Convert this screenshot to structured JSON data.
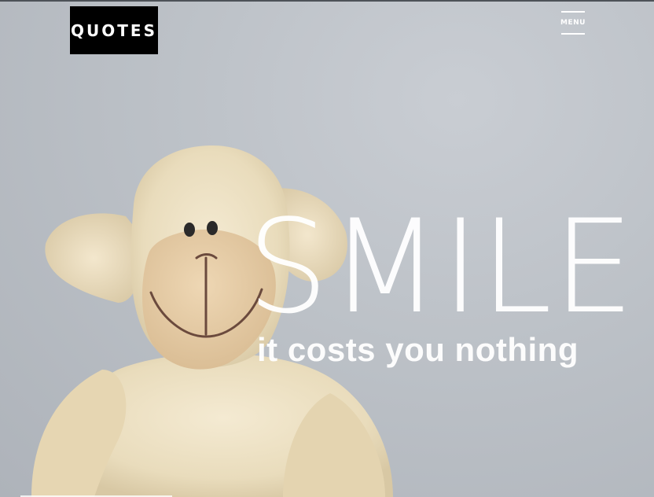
{
  "header": {
    "logo_text": "QUOTES",
    "menu_label": "MENU"
  },
  "hero": {
    "headline": "SMILE",
    "subline": "it costs you nothing",
    "image": "teddy-sheep-plush-toy"
  },
  "colors": {
    "background": "#b9bec5",
    "logo_bg": "#000000",
    "text": "#ffffff",
    "plush": "#efe3c6"
  }
}
